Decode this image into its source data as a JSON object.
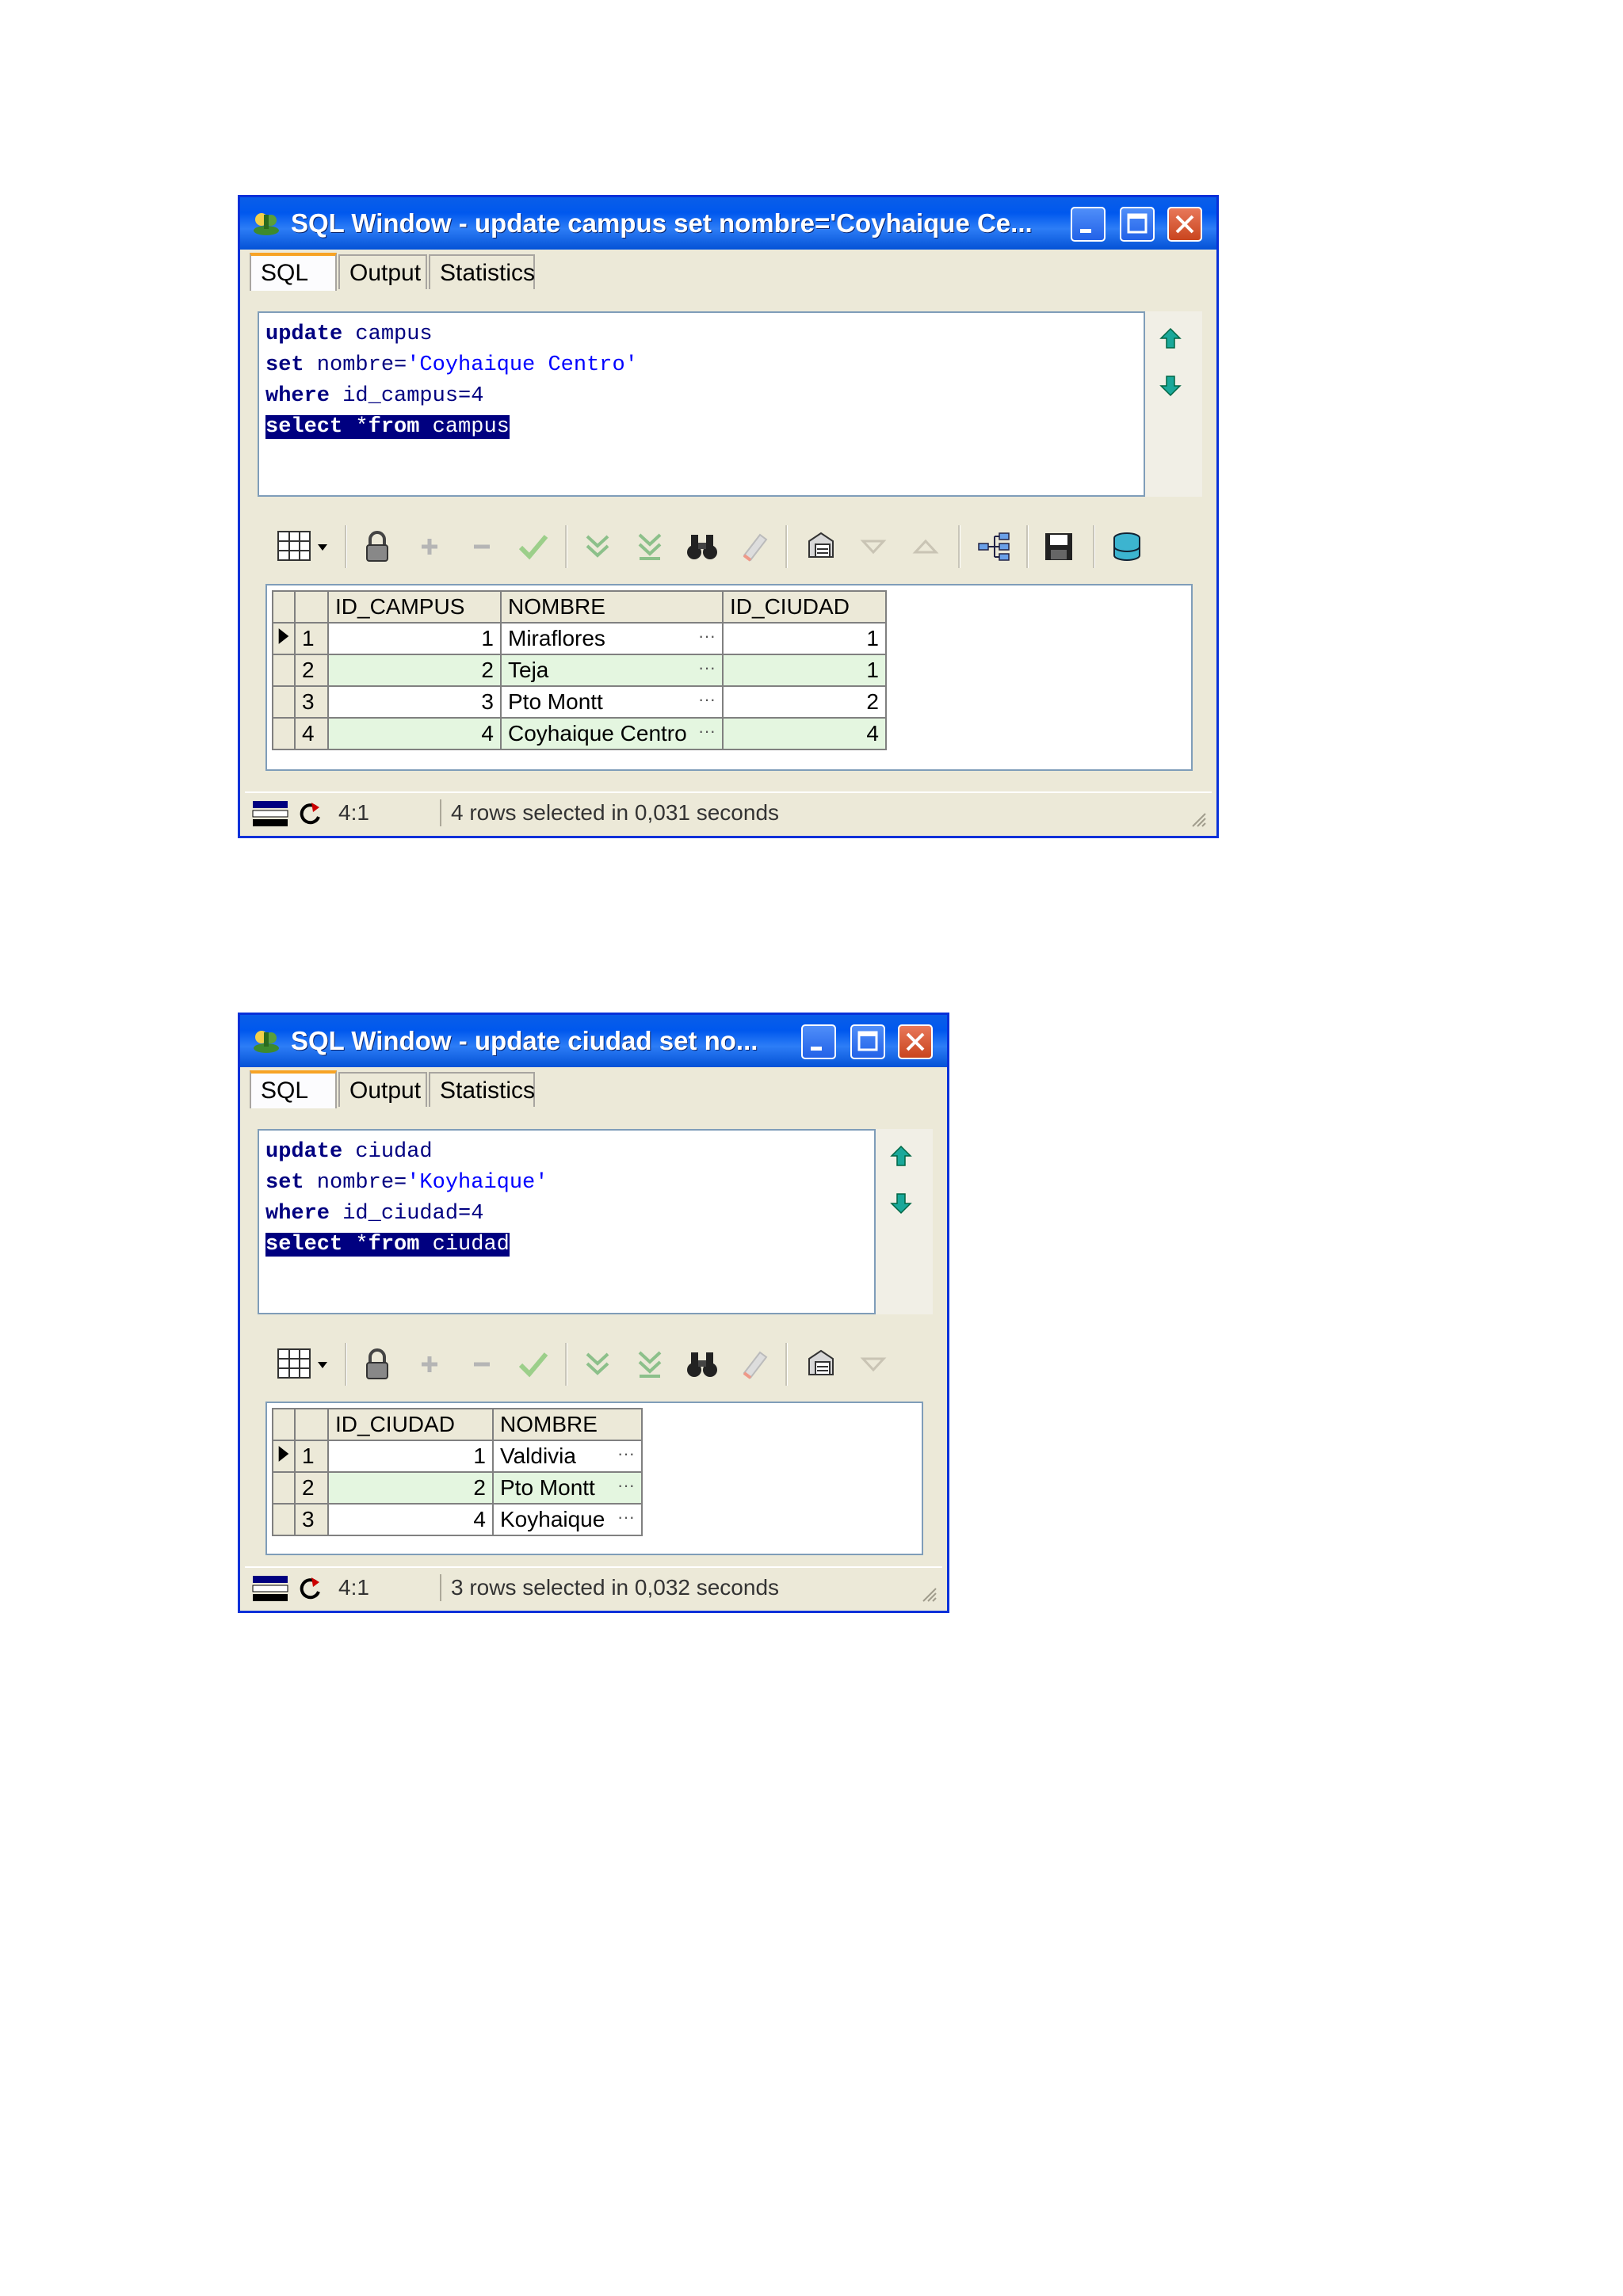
{
  "windows": [
    {
      "title": "SQL Window - update campus set nombre='Coyhaique Ce...",
      "tabs": [
        "SQL",
        "Output",
        "Statistics"
      ],
      "code": {
        "l1_kw": "update",
        "l1_rest": " campus",
        "l2_kw": "set",
        "l2_rest_a": " nombre=",
        "l2_str": "'Coyhaique Centro'",
        "l3_kw": "where",
        "l3_rest": " id_campus=4",
        "l4_kw": "select",
        "l4_mid": " *",
        "l4_kw2": "from",
        "l4_rest": " campus"
      },
      "columns": [
        "ID_CAMPUS",
        "NOMBRE",
        "ID_CIUDAD"
      ],
      "rows": [
        {
          "n": "1",
          "a": "1",
          "b": "Miraflores",
          "c": "1"
        },
        {
          "n": "2",
          "a": "2",
          "b": "Teja",
          "c": "1"
        },
        {
          "n": "3",
          "a": "3",
          "b": "Pto Montt",
          "c": "2"
        },
        {
          "n": "4",
          "a": "4",
          "b": "Coyhaique Centro",
          "c": "4"
        }
      ],
      "status": {
        "position": "4:1",
        "message": "4 rows selected in 0,031 seconds"
      }
    },
    {
      "title": "SQL Window - update ciudad set no...",
      "tabs": [
        "SQL",
        "Output",
        "Statistics"
      ],
      "code": {
        "l1_kw": "update",
        "l1_rest": " ciudad",
        "l2_kw": "set",
        "l2_rest_a": " nombre=",
        "l2_str": "'Koyhaique'",
        "l3_kw": "where",
        "l3_rest": " id_ciudad=4",
        "l4_kw": "select",
        "l4_mid": " *",
        "l4_kw2": "from",
        "l4_rest": " ciudad"
      },
      "columns": [
        "ID_CIUDAD",
        "NOMBRE"
      ],
      "rows": [
        {
          "n": "1",
          "a": "1",
          "b": "Valdivia"
        },
        {
          "n": "2",
          "a": "2",
          "b": "Pto Montt"
        },
        {
          "n": "3",
          "a": "4",
          "b": "Koyhaique"
        }
      ],
      "status": {
        "position": "4:1",
        "message": "3 rows selected in 0,032 seconds"
      }
    }
  ],
  "ellipsis": "···",
  "icons": [
    "app-icon",
    "minimize-icon",
    "maximize-icon",
    "close-icon",
    "arrow-up-icon",
    "arrow-down-icon",
    "grid-view-icon",
    "lock-icon",
    "add-record-icon",
    "delete-record-icon",
    "post-icon",
    "next-page-icon",
    "last-page-icon",
    "find-icon",
    "clear-icon",
    "export-icon",
    "sort-desc-icon",
    "sort-asc-icon",
    "query-plan-icon",
    "save-icon",
    "fetch-icon",
    "connection-icon",
    "refresh-icon",
    "resize-grip-icon"
  ]
}
